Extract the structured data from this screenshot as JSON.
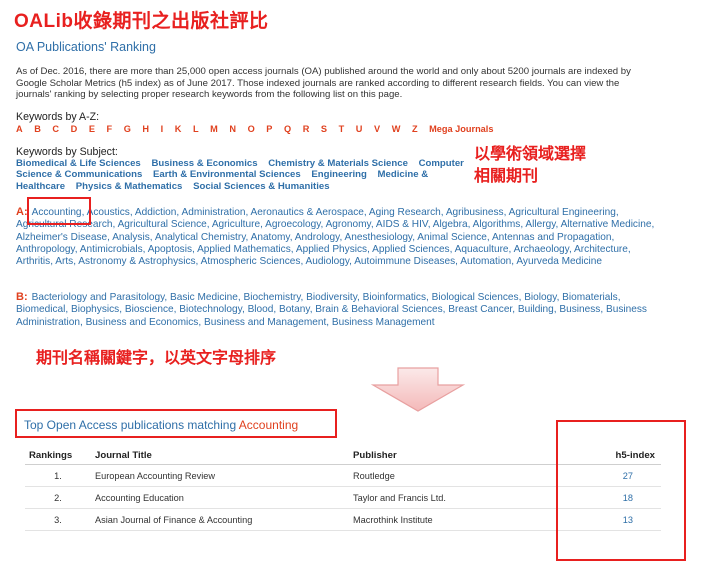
{
  "page_title": "OALib收錄期刊之出版社評比",
  "ranking_heading": "OA Publications' Ranking",
  "intro_text": "As of Dec. 2016, there are more than 25,000 open access journals (OA) published around the world and only about 5200 journals are indexed by Google Scholar Metrics (h5 index) as of June 2017. Those indexed journals are ranked according to different research fields. You can view the journals' ranking by selecting proper research keywords from the following list on this page.",
  "keywords_az_label": "Keywords by A-Z:",
  "az_letters": [
    "A",
    "B",
    "C",
    "D",
    "E",
    "F",
    "G",
    "H",
    "I",
    "K",
    "L",
    "M",
    "N",
    "O",
    "P",
    "Q",
    "R",
    "S",
    "T",
    "U",
    "V",
    "W",
    "Z",
    "Mega Journals"
  ],
  "keywords_subject_label": "Keywords by Subject:",
  "subjects": [
    "Biomedical & Life Sciences",
    "Business & Economics",
    "Chemistry & Materials Science",
    "Computer Science & Communications",
    "Earth & Environmental Sciences",
    "Engineering",
    "Medicine & Healthcare",
    "Physics & Mathematics",
    "Social Sciences & Humanities"
  ],
  "annotation_subject": [
    "以學術領域選擇",
    "相關期刊"
  ],
  "annotation_alpha": "期刊名稱關鍵字，以英文字母排序",
  "keywords_a": {
    "letter": "A:",
    "items": [
      "Accounting",
      "Acoustics",
      "Addiction",
      "Administration",
      "Aeronautics & Aerospace",
      "Aging Research",
      "Agribusiness",
      "Agricultural Engineering",
      "Agricultural Research",
      "Agricultural Science",
      "Agriculture",
      "Agroecology",
      "Agronomy",
      "AIDS & HIV",
      "Algebra",
      "Algorithms",
      "Allergy",
      "Alternative Medicine",
      "Alzheimer's Disease",
      "Analysis",
      "Analytical Chemistry",
      "Anatomy",
      "Andrology",
      "Anesthesiology",
      "Animal Science",
      "Antennas and Propagation",
      "Anthropology",
      "Antimicrobials",
      "Apoptosis",
      "Applied Mathematics",
      "Applied Physics",
      "Applied Sciences",
      "Aquaculture",
      "Archaeology",
      "Architecture",
      "Arthritis",
      "Arts",
      "Astronomy & Astrophysics",
      "Atmospheric Sciences",
      "Audiology",
      "Autoimmune Diseases",
      "Automation",
      "Ayurveda Medicine"
    ]
  },
  "keywords_b": {
    "letter": "B:",
    "items": [
      "Bacteriology and Parasitology",
      "Basic Medicine",
      "Biochemistry",
      "Biodiversity",
      "Bioinformatics",
      "Biological Sciences",
      "Biology",
      "Biomaterials",
      "Biomedical",
      "Biophysics",
      "Bioscience",
      "Biotechnology",
      "Blood",
      "Botany",
      "Brain & Behavioral Sciences",
      "Breast Cancer",
      "Building",
      "Business",
      "Business Administration",
      "Business and Economics",
      "Business and Management",
      "Business Management"
    ]
  },
  "results": {
    "title_prefix": "Top Open Access publications matching",
    "title_keyword": "Accounting",
    "headers": [
      "Rankings",
      "Journal Title",
      "Publisher",
      "h5-index"
    ],
    "rows": [
      {
        "rank": "1.",
        "title": "European Accounting Review",
        "publisher": "Routledge",
        "h5": "27"
      },
      {
        "rank": "2.",
        "title": "Accounting Education",
        "publisher": "Taylor and Francis Ltd.",
        "h5": "18"
      },
      {
        "rank": "3.",
        "title": "Asian Journal of Finance & Accounting",
        "publisher": "Macrothink Institute",
        "h5": "13"
      }
    ]
  },
  "colors": {
    "annotation_red": "#e8201f",
    "link_blue": "#2f6fa8",
    "letter_orange": "#e0411f"
  }
}
